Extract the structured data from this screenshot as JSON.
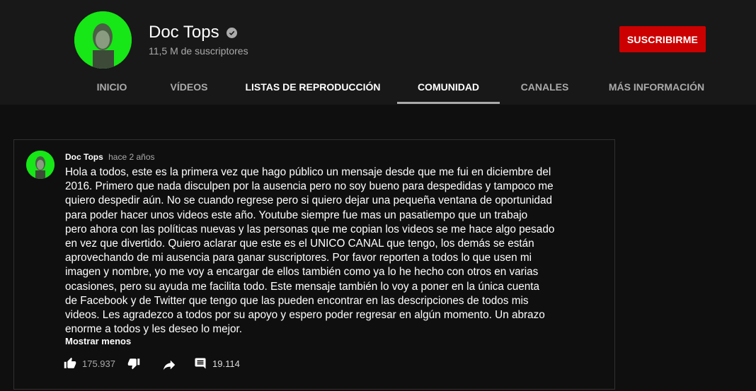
{
  "channel": {
    "name": "Doc Tops",
    "subscribers": "11,5 M de suscriptores",
    "verified": true,
    "avatar_color": "#17e617"
  },
  "subscribe": {
    "label": "SUSCRIBIRME",
    "color": "#cc0000"
  },
  "tabs": [
    {
      "label": "INICIO",
      "active": false
    },
    {
      "label": "VÍDEOS",
      "active": false
    },
    {
      "label": "LISTAS DE REPRODUCCIÓN",
      "active": false
    },
    {
      "label": "COMUNIDAD",
      "active": true
    },
    {
      "label": "CANALES",
      "active": false
    },
    {
      "label": "MÁS INFORMACIÓN",
      "active": false
    }
  ],
  "post": {
    "author": "Doc Tops",
    "time": "hace 2 años",
    "body": "Hola a todos, este es la primera vez que hago público un mensaje desde que me fui en diciembre del\n2016.  Primero que nada disculpen por la ausencia pero no soy bueno para despedidas y tampoco me\nquiero despedir aún.  No se cuando regrese pero si quiero dejar una pequeña ventana de oportunidad\npara poder hacer unos videos este año.   Youtube siempre fue mas un pasatiempo que un trabajo\npero ahora con las políticas nuevas y las personas que me copian los videos se me hace algo pesado\nen vez que divertido.  Quiero aclarar que este es el UNICO CANAL que tengo, los demás se están\naprovechando de mi ausencia para ganar suscriptores.  Por favor reporten a todos lo que usen mi\nimagen y nombre, yo me voy a encargar de ellos también como ya lo he hecho con otros en varias\nocasiones, pero su ayuda me facilita todo.   Este mensaje también lo voy a poner en la única cuenta\nde Facebook y de Twitter que tengo que las pueden encontrar en las descripciones de todos mis\nvideos.  Les agradezco a todos por su apoyo y espero poder regresar en algún momento.  Un abrazo\nenorme a todos y les deseo lo mejor.",
    "show_less": "Mostrar menos",
    "likes": "175.937",
    "comments": "19.114"
  }
}
